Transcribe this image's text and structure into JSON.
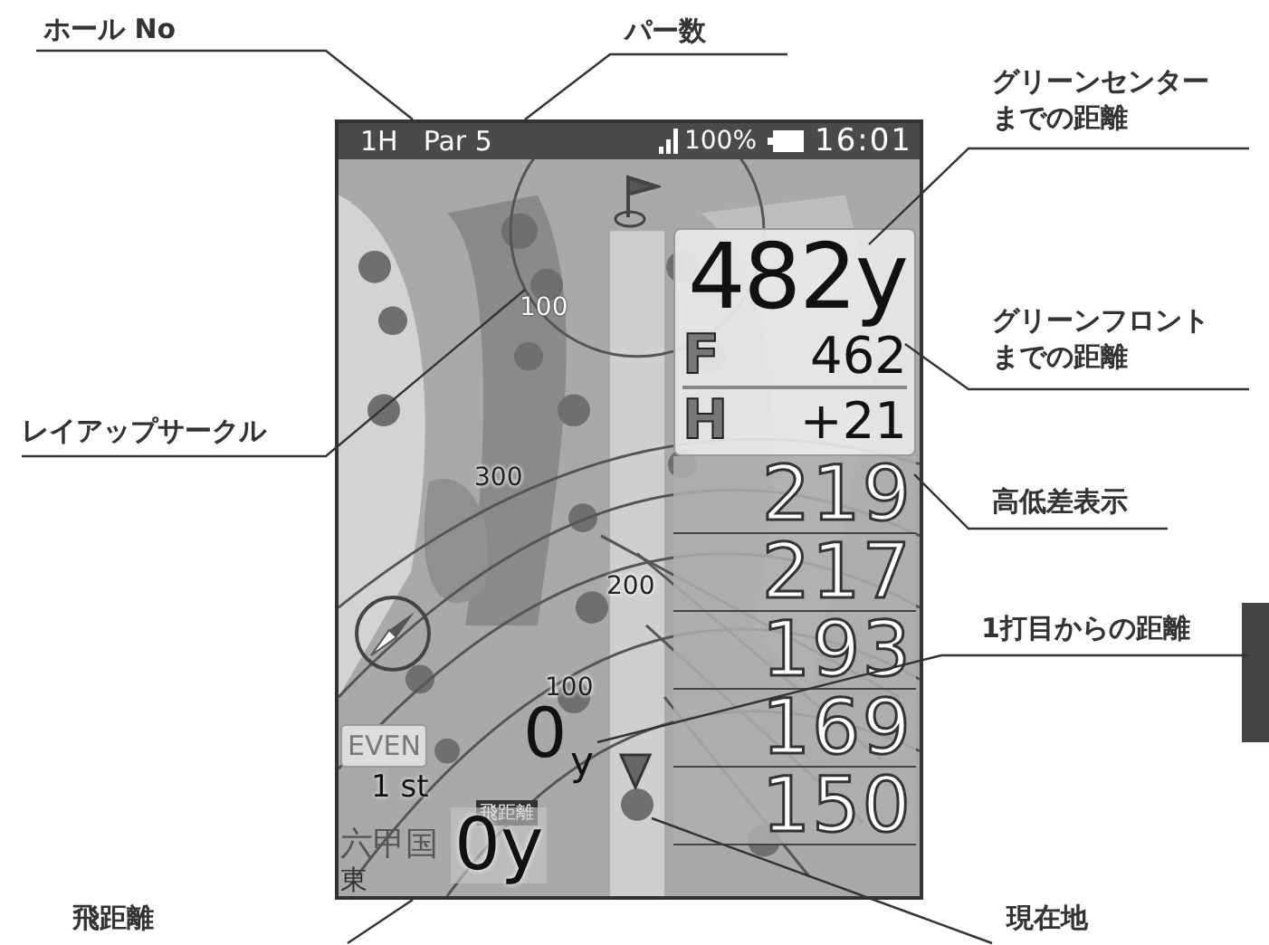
{
  "callouts": [
    {
      "text": "ホール No"
    },
    {
      "text": "パー数"
    },
    {
      "text": "グリーンセンター",
      "line2": "までの距離"
    },
    {
      "text": "グリーンフロント",
      "line2": "までの距離"
    },
    {
      "text": "高低差表示"
    },
    {
      "text": "レイアップサークル"
    },
    {
      "text": "1打目からの距離"
    },
    {
      "text": "飛距離"
    },
    {
      "text": "現在地"
    }
  ],
  "screen": {
    "status_bar": {
      "hole": "1H",
      "par": "Par 5",
      "battery": "100%",
      "time": "16:01"
    },
    "map_labels": [
      "100",
      "300",
      "200",
      "100"
    ],
    "green_center": "482y",
    "green_front": {
      "label": "F",
      "value": "462"
    },
    "elevation": {
      "label": "H",
      "value": "+21"
    },
    "distances": [
      "219",
      "217",
      "193",
      "169",
      "150"
    ],
    "first_shot": {
      "value": "0",
      "unit": "y"
    },
    "score": "EVEN",
    "shot": "1 st",
    "carry_badge": "飛距離",
    "carry": "0y",
    "course_name": "六甲国",
    "course_label": "東"
  }
}
